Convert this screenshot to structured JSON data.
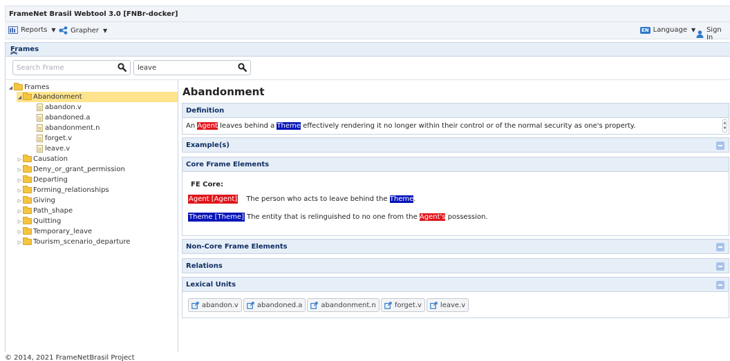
{
  "app": {
    "title": "FrameNet Brasil Webtool 3.0 [FNBr-docker]"
  },
  "menubar": {
    "reports_label": "Reports",
    "grapher_label": "Grapher",
    "language_badge": "EN",
    "language_label": "Language",
    "signin_label": "Sign In"
  },
  "panel": {
    "title": "Frames"
  },
  "search": {
    "frame_placeholder": "Search Frame",
    "lu_value": "leave"
  },
  "tree": {
    "root": "Frames",
    "selected": "Abandonment",
    "lus": [
      "abandon.v",
      "abandoned.a",
      "abandonment.n",
      "forget.v",
      "leave.v"
    ],
    "frames": [
      "Causation",
      "Deny_or_grant_permission",
      "Departing",
      "Forming_relationships",
      "Giving",
      "Path_shape",
      "Quitting",
      "Temporary_leave",
      "Tourism_scenario_departure"
    ]
  },
  "frame": {
    "title": "Abandonment",
    "definition": {
      "header": "Definition",
      "t1": "An ",
      "agent": "Agent",
      "t2": " leaves behind a ",
      "theme": "Theme",
      "t3": " effectively rendering it no longer within their control or of the normal security as one's property."
    },
    "examples_header": "Example(s)",
    "core": {
      "header": "Core Frame Elements",
      "fe_core_label": "FE Core:",
      "agent_tag": "Agent [Agent]",
      "agent_desc": "The person who acts to leave behind the ",
      "agent_desc_theme": "Theme",
      "agent_desc_end": ".",
      "theme_tag": "Theme [Theme]",
      "theme_desc": "The entity that is relinguished to no one from the ",
      "theme_desc_agent": "Agent's",
      "theme_desc_end": " possession."
    },
    "noncore_header": "Non-Core Frame Elements",
    "relations_header": "Relations",
    "lexical_header": "Lexical Units",
    "lexical_units": [
      "abandon.v",
      "abandoned.a",
      "abandonment.n",
      "forget.v",
      "leave.v"
    ]
  },
  "footer": "© 2014, 2021 FrameNetBrasil Project",
  "colors": {
    "agent": "#e0151b",
    "theme": "#0615b8",
    "selected": "#ffe48d",
    "header_bg": "#e6eef8"
  }
}
